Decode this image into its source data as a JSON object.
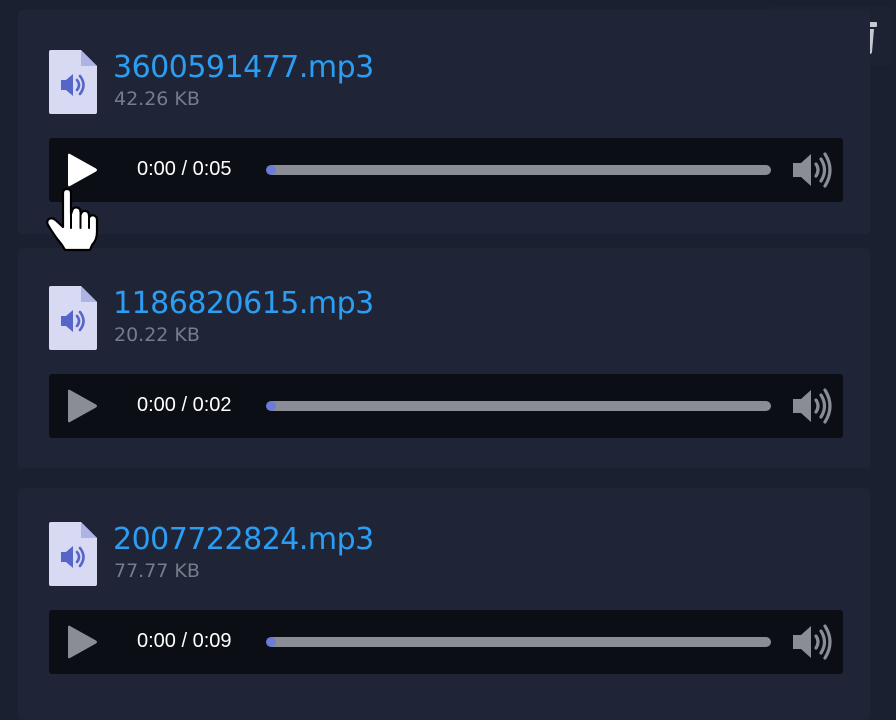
{
  "toolbar": {
    "download_icon": "download-icon",
    "delete_icon": "trash-icon"
  },
  "files": [
    {
      "name": "3600591477.mp3",
      "size": "42.26 KB",
      "time": "0:00 / 0:05",
      "progress": 0
    },
    {
      "name": "1186820615.mp3",
      "size": "20.22 KB",
      "time": "0:00 / 0:02",
      "progress": 0
    },
    {
      "name": "2007722824.mp3",
      "size": "77.77 KB",
      "time": "0:00 / 0:09",
      "progress": 0
    }
  ],
  "colors": {
    "background": "#1b2030",
    "card": "#1f2537",
    "filename": "#2b9df2",
    "size_text": "#757c8a",
    "player": "#0c0e16",
    "file_icon": "#d8d9f2",
    "file_icon_glyph": "#5565c8",
    "progress_accent": "#6b7bd6"
  }
}
